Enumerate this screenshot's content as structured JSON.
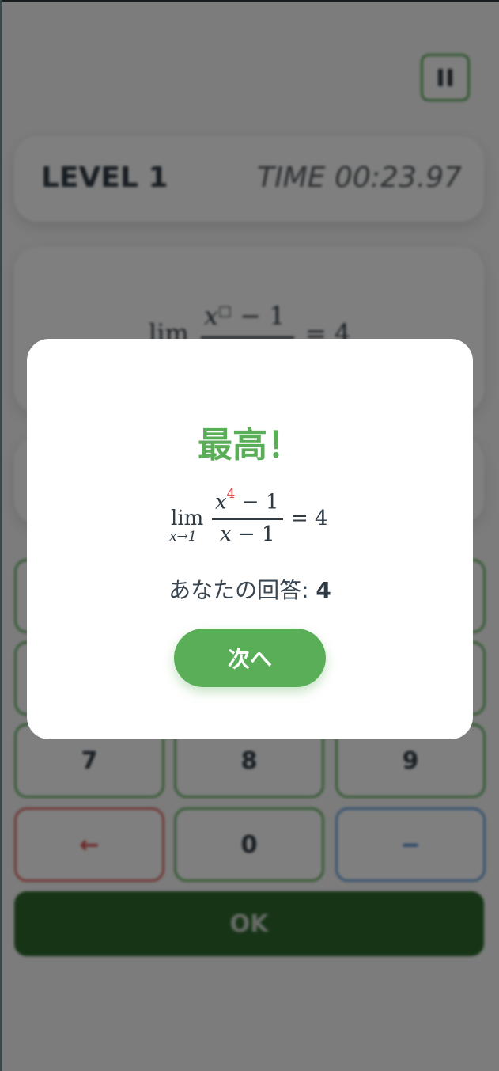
{
  "header": {
    "pause_icon": "pause-icon"
  },
  "status": {
    "level": "LEVEL 1",
    "time": "TIME 00:23.97"
  },
  "problem": {
    "lim": "lim",
    "numerator_var": "x",
    "numerator_placeholder": "□",
    "numerator_rest": " − 1",
    "rhs": "= 4"
  },
  "keypad": {
    "keys": [
      {
        "label": "7"
      },
      {
        "label": "8"
      },
      {
        "label": "9"
      },
      {
        "label": "←"
      },
      {
        "label": "0"
      },
      {
        "label": "−"
      }
    ],
    "ok": "OK"
  },
  "modal": {
    "title": "最高！",
    "math": {
      "lim": "lim",
      "sub": "x→1",
      "num_var": "x",
      "num_exp": "4",
      "num_rest": " − 1",
      "den_var": "x",
      "den_rest": " − 1",
      "rhs": "= 4"
    },
    "answer_label": "あなたの回答: ",
    "answer_value": "4",
    "next_button": "次へ"
  },
  "colors": {
    "accent": "#5aae58",
    "dark_green": "#2e6b2d",
    "highlight": "#e53935"
  }
}
